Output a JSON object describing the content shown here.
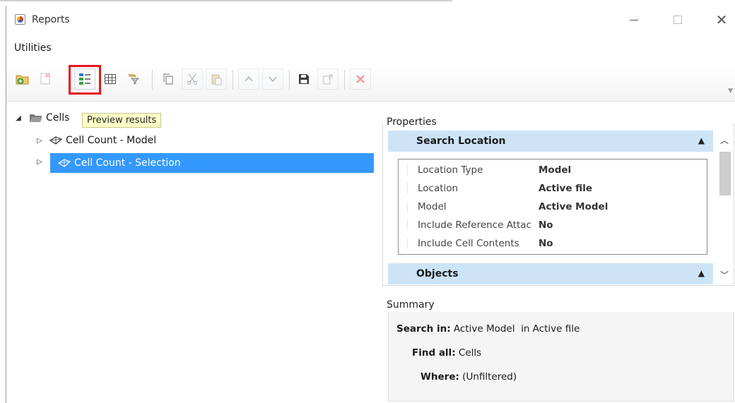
{
  "window": {
    "title": "Reports",
    "close_glyph": "✕"
  },
  "menu": {
    "items": [
      "Utilities"
    ]
  },
  "toolbar": {
    "icons": [
      "new-folder-icon",
      "new-report-icon",
      "preview-results-icon",
      "table-icon",
      "filter-icon",
      "copy-icon",
      "cut-icon",
      "paste-icon",
      "move-up-icon",
      "move-down-icon",
      "save-icon",
      "export-icon",
      "delete-icon"
    ],
    "tooltip": "Preview results",
    "highlight_color": "#e8141c"
  },
  "tree": {
    "root_label": "Cells",
    "items": [
      {
        "label": "Cell Count - Model",
        "selected": false
      },
      {
        "label": "Cell Count - Selection",
        "selected": true
      }
    ],
    "selection_color": "#3399ff"
  },
  "properties": {
    "label": "Properties",
    "categories": [
      {
        "title": "Search Location",
        "rows": [
          {
            "name": "Location Type",
            "value": "Model"
          },
          {
            "name": "Location",
            "value": "Active file"
          },
          {
            "name": "Model",
            "value": "Active Model"
          },
          {
            "name": "Include Reference Attac",
            "value": "No"
          },
          {
            "name": "Include Cell Contents",
            "value": "No"
          }
        ]
      },
      {
        "title": "Objects",
        "rows": []
      }
    ],
    "header_color": "#cde4f7"
  },
  "summary": {
    "label": "Summary",
    "search_in_label": "Search in:",
    "search_in_value": "Active Model  in Active file",
    "find_all_label": "Find all:",
    "find_all_value": "Cells",
    "where_label": "Where:",
    "where_value": "(Unfiltered)"
  }
}
